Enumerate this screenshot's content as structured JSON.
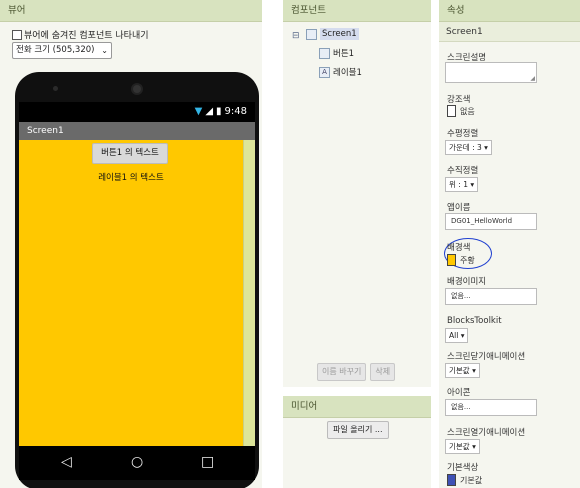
{
  "viewer": {
    "header": "뷰어",
    "show_hidden_label": "뷰어에 숨겨진 컴포넌트 나타내기",
    "size_select": "전화 크기 (505,320)",
    "phone": {
      "time": "9:48",
      "screen_title": "Screen1",
      "button_text": "버튼1 의 텍스트",
      "label_text": "레이블1 의 텍스트",
      "screen_color": "#ffc800"
    }
  },
  "components": {
    "header": "컴포넌트",
    "tree": [
      "Screen1",
      "버튼1",
      "레이블1"
    ],
    "rename_button": "이름 바꾸기",
    "delete_button": "삭제"
  },
  "media": {
    "header": "미디어",
    "upload_button": "파일 올리기 ..."
  },
  "properties": {
    "header": "속성",
    "title": "Screen1",
    "about_label": "스크린설명",
    "accent_label": "강조색",
    "accent_value": "없음",
    "halign_label": "수평정렬",
    "halign_value": "가운데 : 3",
    "valign_label": "수직정렬",
    "valign_value": "위 : 1",
    "appname_label": "앱이름",
    "appname_value": "DG01_HelloWorld",
    "bgcolor_label": "배경색",
    "bgcolor_value": "주황",
    "bgcolor_color": "#ffc800",
    "bgimage_label": "배경이미지",
    "bgimage_value": "없음...",
    "blocks_label": "BlocksToolkit",
    "blocks_value": "All",
    "close_anim_label": "스크린닫기애니메이션",
    "close_anim_value": "기본값",
    "icon_label": "아이콘",
    "icon_value": "없음...",
    "open_anim_label": "스크린열기애니메이션",
    "open_anim_value": "기본값",
    "primary_label": "기본색상",
    "primary_value": "기본값",
    "primary_color": "#3f51b5"
  }
}
